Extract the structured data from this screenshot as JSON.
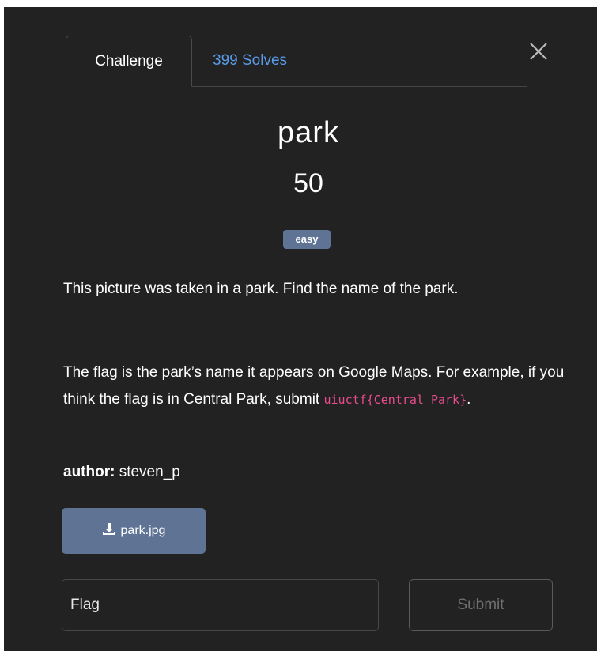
{
  "tabs": {
    "challenge_label": "Challenge",
    "solves_label": "399 Solves"
  },
  "challenge": {
    "name": "park",
    "points": "50",
    "tag": "easy",
    "description_1": "This picture was taken in a park. Find the name of the park.",
    "description_2_before": "The flag is the park’s name it appears on Google Maps. For example, if you think the flag is in Central Park, submit ",
    "description_2_code": "uiuctf{Central Park}",
    "description_2_after": ".",
    "author_label": "author:",
    "author_name": " steven_p"
  },
  "file": {
    "label": "park.jpg",
    "icon": "download-icon"
  },
  "flag_form": {
    "placeholder": "Flag",
    "submit_label": "Submit"
  },
  "colors": {
    "background": "#222222",
    "accent": "#5f7495",
    "link": "#5a9bea",
    "code": "#e74c8c"
  }
}
